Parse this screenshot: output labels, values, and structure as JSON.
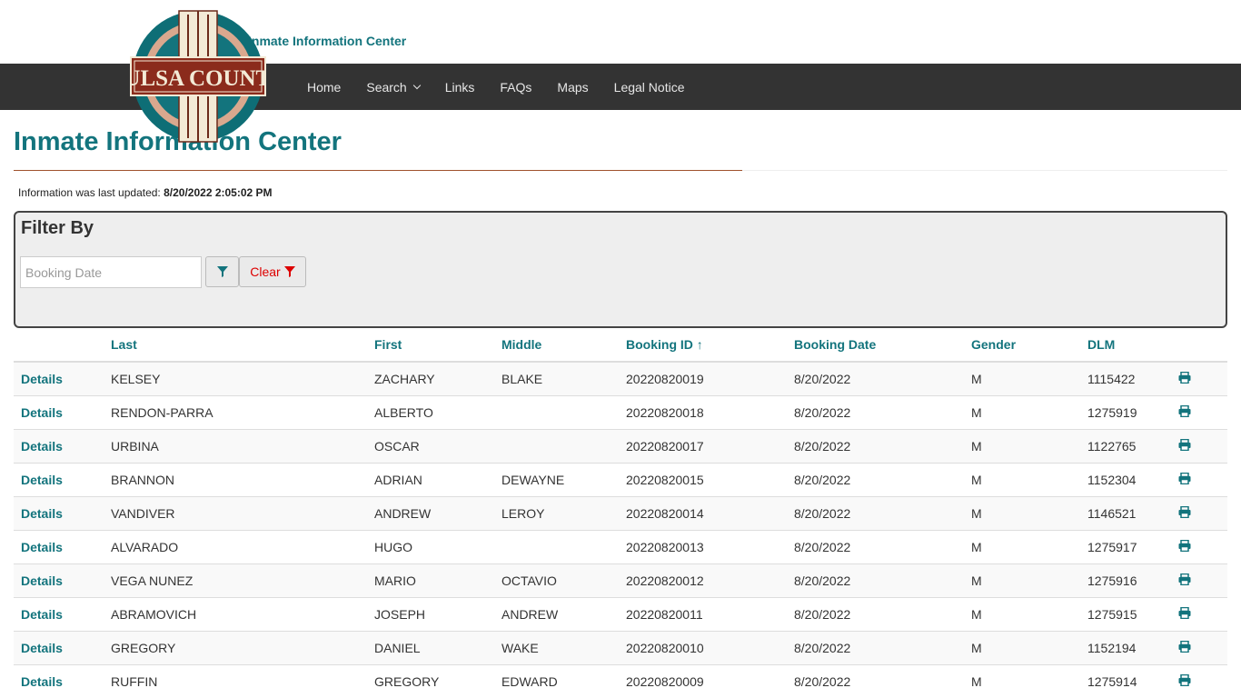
{
  "header": {
    "site_title": "Inmate Information Center",
    "logo_text": "TULSA COUNTY"
  },
  "nav": {
    "items": [
      "Home",
      "Search",
      "Links",
      "FAQs",
      "Maps",
      "Legal Notice"
    ]
  },
  "page": {
    "title": "Inmate Information Center",
    "updated_label": "Information was last updated:",
    "updated_value": "8/20/2022 2:05:02 PM"
  },
  "filter": {
    "title": "Filter By",
    "date_placeholder": "Booking Date",
    "clear_label": "Clear"
  },
  "table": {
    "columns": [
      "",
      "Last",
      "First",
      "Middle",
      "Booking ID ↑",
      "Booking Date",
      "Gender",
      "DLM",
      ""
    ],
    "details_label": "Details",
    "rows": [
      {
        "last": "KELSEY",
        "first": "ZACHARY",
        "middle": "BLAKE",
        "booking_id": "20220820019",
        "booking_date": "8/20/2022",
        "gender": "M",
        "dlm": "1115422"
      },
      {
        "last": "RENDON-PARRA",
        "first": "ALBERTO",
        "middle": "",
        "booking_id": "20220820018",
        "booking_date": "8/20/2022",
        "gender": "M",
        "dlm": "1275919"
      },
      {
        "last": "URBINA",
        "first": "OSCAR",
        "middle": "",
        "booking_id": "20220820017",
        "booking_date": "8/20/2022",
        "gender": "M",
        "dlm": "1122765"
      },
      {
        "last": "BRANNON",
        "first": "ADRIAN",
        "middle": "DEWAYNE",
        "booking_id": "20220820015",
        "booking_date": "8/20/2022",
        "gender": "M",
        "dlm": "1152304"
      },
      {
        "last": "VANDIVER",
        "first": "ANDREW",
        "middle": "LEROY",
        "booking_id": "20220820014",
        "booking_date": "8/20/2022",
        "gender": "M",
        "dlm": "1146521"
      },
      {
        "last": "ALVARADO",
        "first": "HUGO",
        "middle": "",
        "booking_id": "20220820013",
        "booking_date": "8/20/2022",
        "gender": "M",
        "dlm": "1275917"
      },
      {
        "last": "VEGA NUNEZ",
        "first": "MARIO",
        "middle": "OCTAVIO",
        "booking_id": "20220820012",
        "booking_date": "8/20/2022",
        "gender": "M",
        "dlm": "1275916"
      },
      {
        "last": "ABRAMOVICH",
        "first": "JOSEPH",
        "middle": "ANDREW",
        "booking_id": "20220820011",
        "booking_date": "8/20/2022",
        "gender": "M",
        "dlm": "1275915"
      },
      {
        "last": "GREGORY",
        "first": "DANIEL",
        "middle": "WAKE",
        "booking_id": "20220820010",
        "booking_date": "8/20/2022",
        "gender": "M",
        "dlm": "1152194"
      },
      {
        "last": "RUFFIN",
        "first": "GREGORY",
        "middle": "EDWARD",
        "booking_id": "20220820009",
        "booking_date": "8/20/2022",
        "gender": "M",
        "dlm": "1275914"
      }
    ]
  },
  "colors": {
    "accent": "#13747d",
    "navbar": "#333333",
    "danger": "#dd0000"
  }
}
